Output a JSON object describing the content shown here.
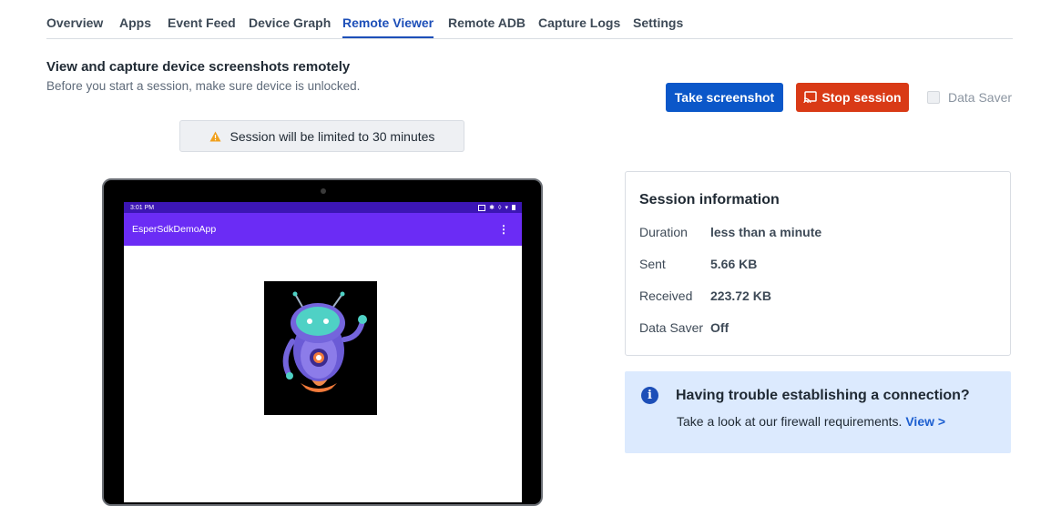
{
  "tabs": [
    {
      "label": "Overview"
    },
    {
      "label": "Apps"
    },
    {
      "label": "Event Feed"
    },
    {
      "label": "Device Graph"
    },
    {
      "label": "Remote Viewer",
      "active": true
    },
    {
      "label": "Remote ADB"
    },
    {
      "label": "Capture Logs"
    },
    {
      "label": "Settings"
    }
  ],
  "header": {
    "title": "View and capture device screenshots remotely",
    "subtitle": "Before you start a session, make sure device is unlocked."
  },
  "actions": {
    "take_screenshot": "Take screenshot",
    "stop_session": "Stop session",
    "stop_session_icon": "cast-icon",
    "data_saver_label": "Data Saver",
    "data_saver_checked": false
  },
  "notice": {
    "icon": "warning-icon",
    "text": "Session will be limited to 30 minutes"
  },
  "device": {
    "status_time": "3:01 PM",
    "app_title": "EsperSdkDemoApp",
    "menu_icon": "more-vert-icon"
  },
  "session_info": {
    "title": "Session information",
    "rows": [
      {
        "label": "Duration",
        "value": "less than a minute"
      },
      {
        "label": "Sent",
        "value": "5.66 KB"
      },
      {
        "label": "Received",
        "value": "223.72 KB"
      },
      {
        "label": "Data Saver",
        "value": "Off"
      }
    ]
  },
  "help": {
    "icon": "info-icon",
    "title": "Having trouble establishing a connection?",
    "text": "Take a look at our firewall requirements.",
    "link": "View >"
  },
  "colors": {
    "primary": "#0b57c9",
    "danger": "#d93a16",
    "tab_active": "#1d4fb8",
    "warning": "#f0a01c",
    "device_statusbar": "#3c16b4",
    "device_appbar": "#6b2cf5",
    "help_bg": "#dceafe"
  }
}
